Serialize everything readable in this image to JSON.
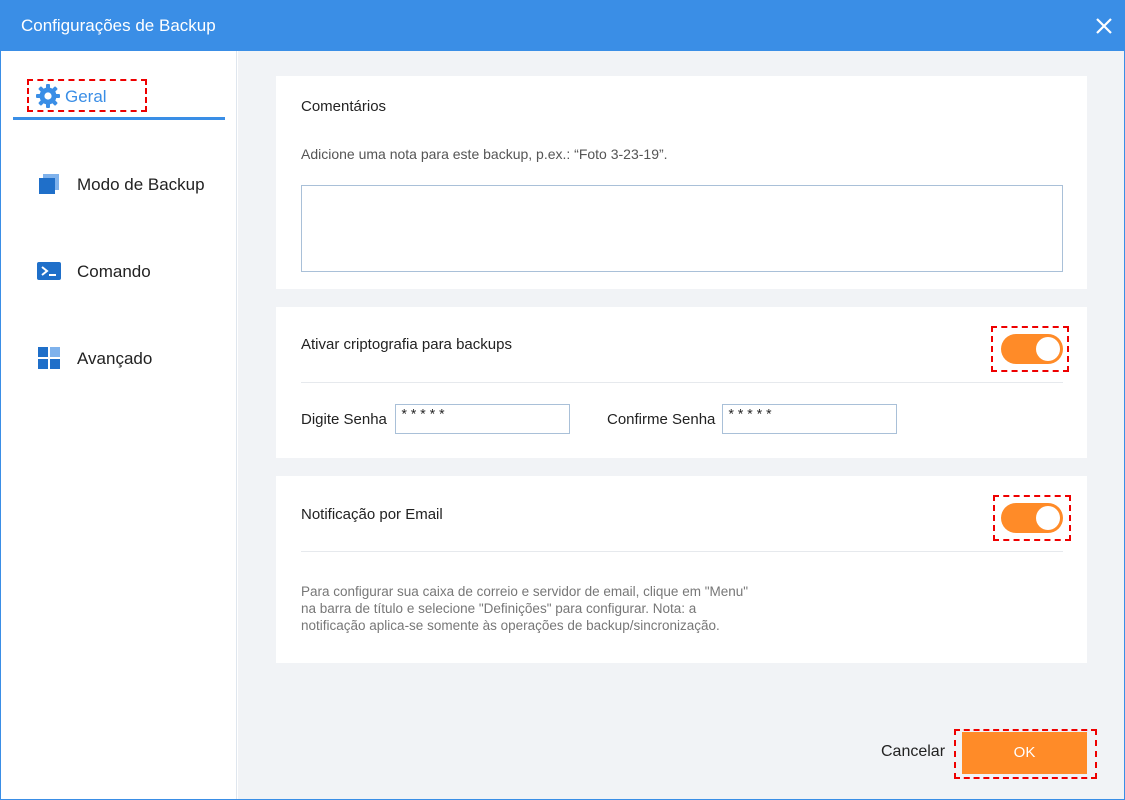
{
  "window": {
    "title": "Configurações de Backup"
  },
  "sidebar": {
    "items": [
      {
        "label": "Geral",
        "icon": "gear-icon",
        "active": true
      },
      {
        "label": "Modo de Backup",
        "icon": "copy-icon"
      },
      {
        "label": "Comando",
        "icon": "terminal-icon"
      },
      {
        "label": "Avançado",
        "icon": "grid-icon"
      }
    ]
  },
  "comments": {
    "title": "Comentários",
    "hint": "Adicione uma nota para este backup, p.ex.: “Foto 3-23-19”.",
    "value": ""
  },
  "encryption": {
    "title": "Ativar criptografia para backups",
    "enabled": true,
    "password_label": "Digite Senha",
    "password_value": "*****",
    "confirm_label": "Confirme Senha",
    "confirm_value": "*****"
  },
  "email": {
    "title": "Notificação por Email",
    "enabled": true,
    "note": "Para configurar sua caixa de correio e servidor de email, clique em \"Menu\"\n na barra de título e selecione \"Definições\" para configurar. Nota: a\nnotificação aplica-se somente às operações de backup/sincronização."
  },
  "footer": {
    "cancel_label": "Cancelar",
    "ok_label": "OK"
  },
  "colors": {
    "accent": "#3a8ee6",
    "toggle_on": "#ff8b28",
    "ok_button": "#ff8b28",
    "highlight": "#ee0000"
  }
}
